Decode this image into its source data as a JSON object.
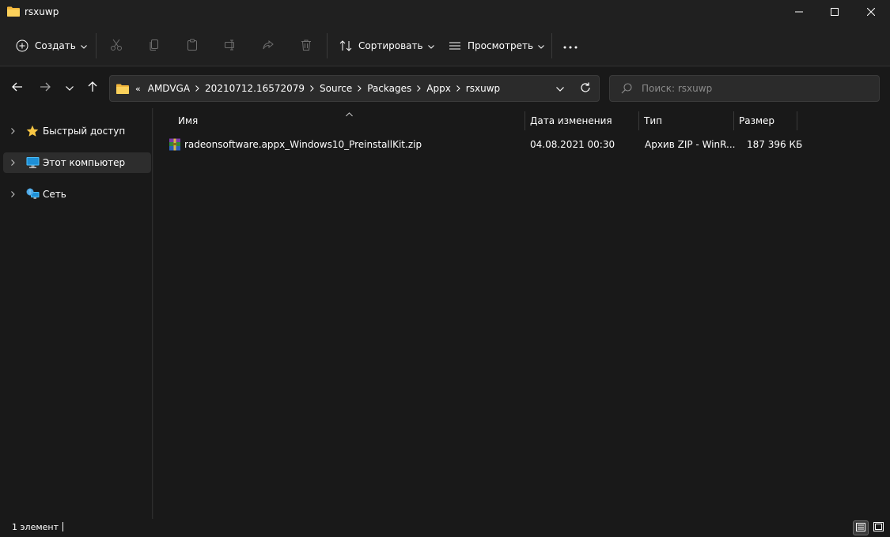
{
  "window": {
    "title": "rsxuwp",
    "minimize_icon": "minimize-icon",
    "maximize_icon": "maximize-icon",
    "close_icon": "close-icon"
  },
  "toolbar": {
    "new_label": "Создать",
    "sort_label": "Сортировать",
    "view_label": "Просмотреть",
    "icons": [
      "cut-icon",
      "copy-icon",
      "paste-icon",
      "rename-icon",
      "share-icon",
      "delete-icon",
      "more-icon"
    ]
  },
  "address": {
    "overflow": "«",
    "crumbs": [
      "AMDVGA",
      "20210712.16572079",
      "Source",
      "Packages",
      "Appx",
      "rsxuwp"
    ]
  },
  "search": {
    "placeholder": "Поиск: rsxuwp"
  },
  "sidebar": {
    "items": [
      {
        "label": "Быстрый доступ",
        "icon": "star-icon"
      },
      {
        "label": "Этот компьютер",
        "icon": "computer-icon"
      },
      {
        "label": "Сеть",
        "icon": "network-icon"
      }
    ]
  },
  "columns": {
    "name": "Имя",
    "date": "Дата изменения",
    "type": "Тип",
    "size": "Размер"
  },
  "files": [
    {
      "name": "radeonsoftware.appx_Windows10_PreinstallKit.zip",
      "date": "04.08.2021 00:30",
      "type": "Архив ZIP - WinR...",
      "size": "187 396 КБ",
      "icon": "winrar-archive-icon"
    }
  ],
  "status": {
    "count": "1 элемент"
  },
  "colors": {
    "accent": "#60cdff",
    "folder": "#f8c644",
    "background": "#191919"
  }
}
